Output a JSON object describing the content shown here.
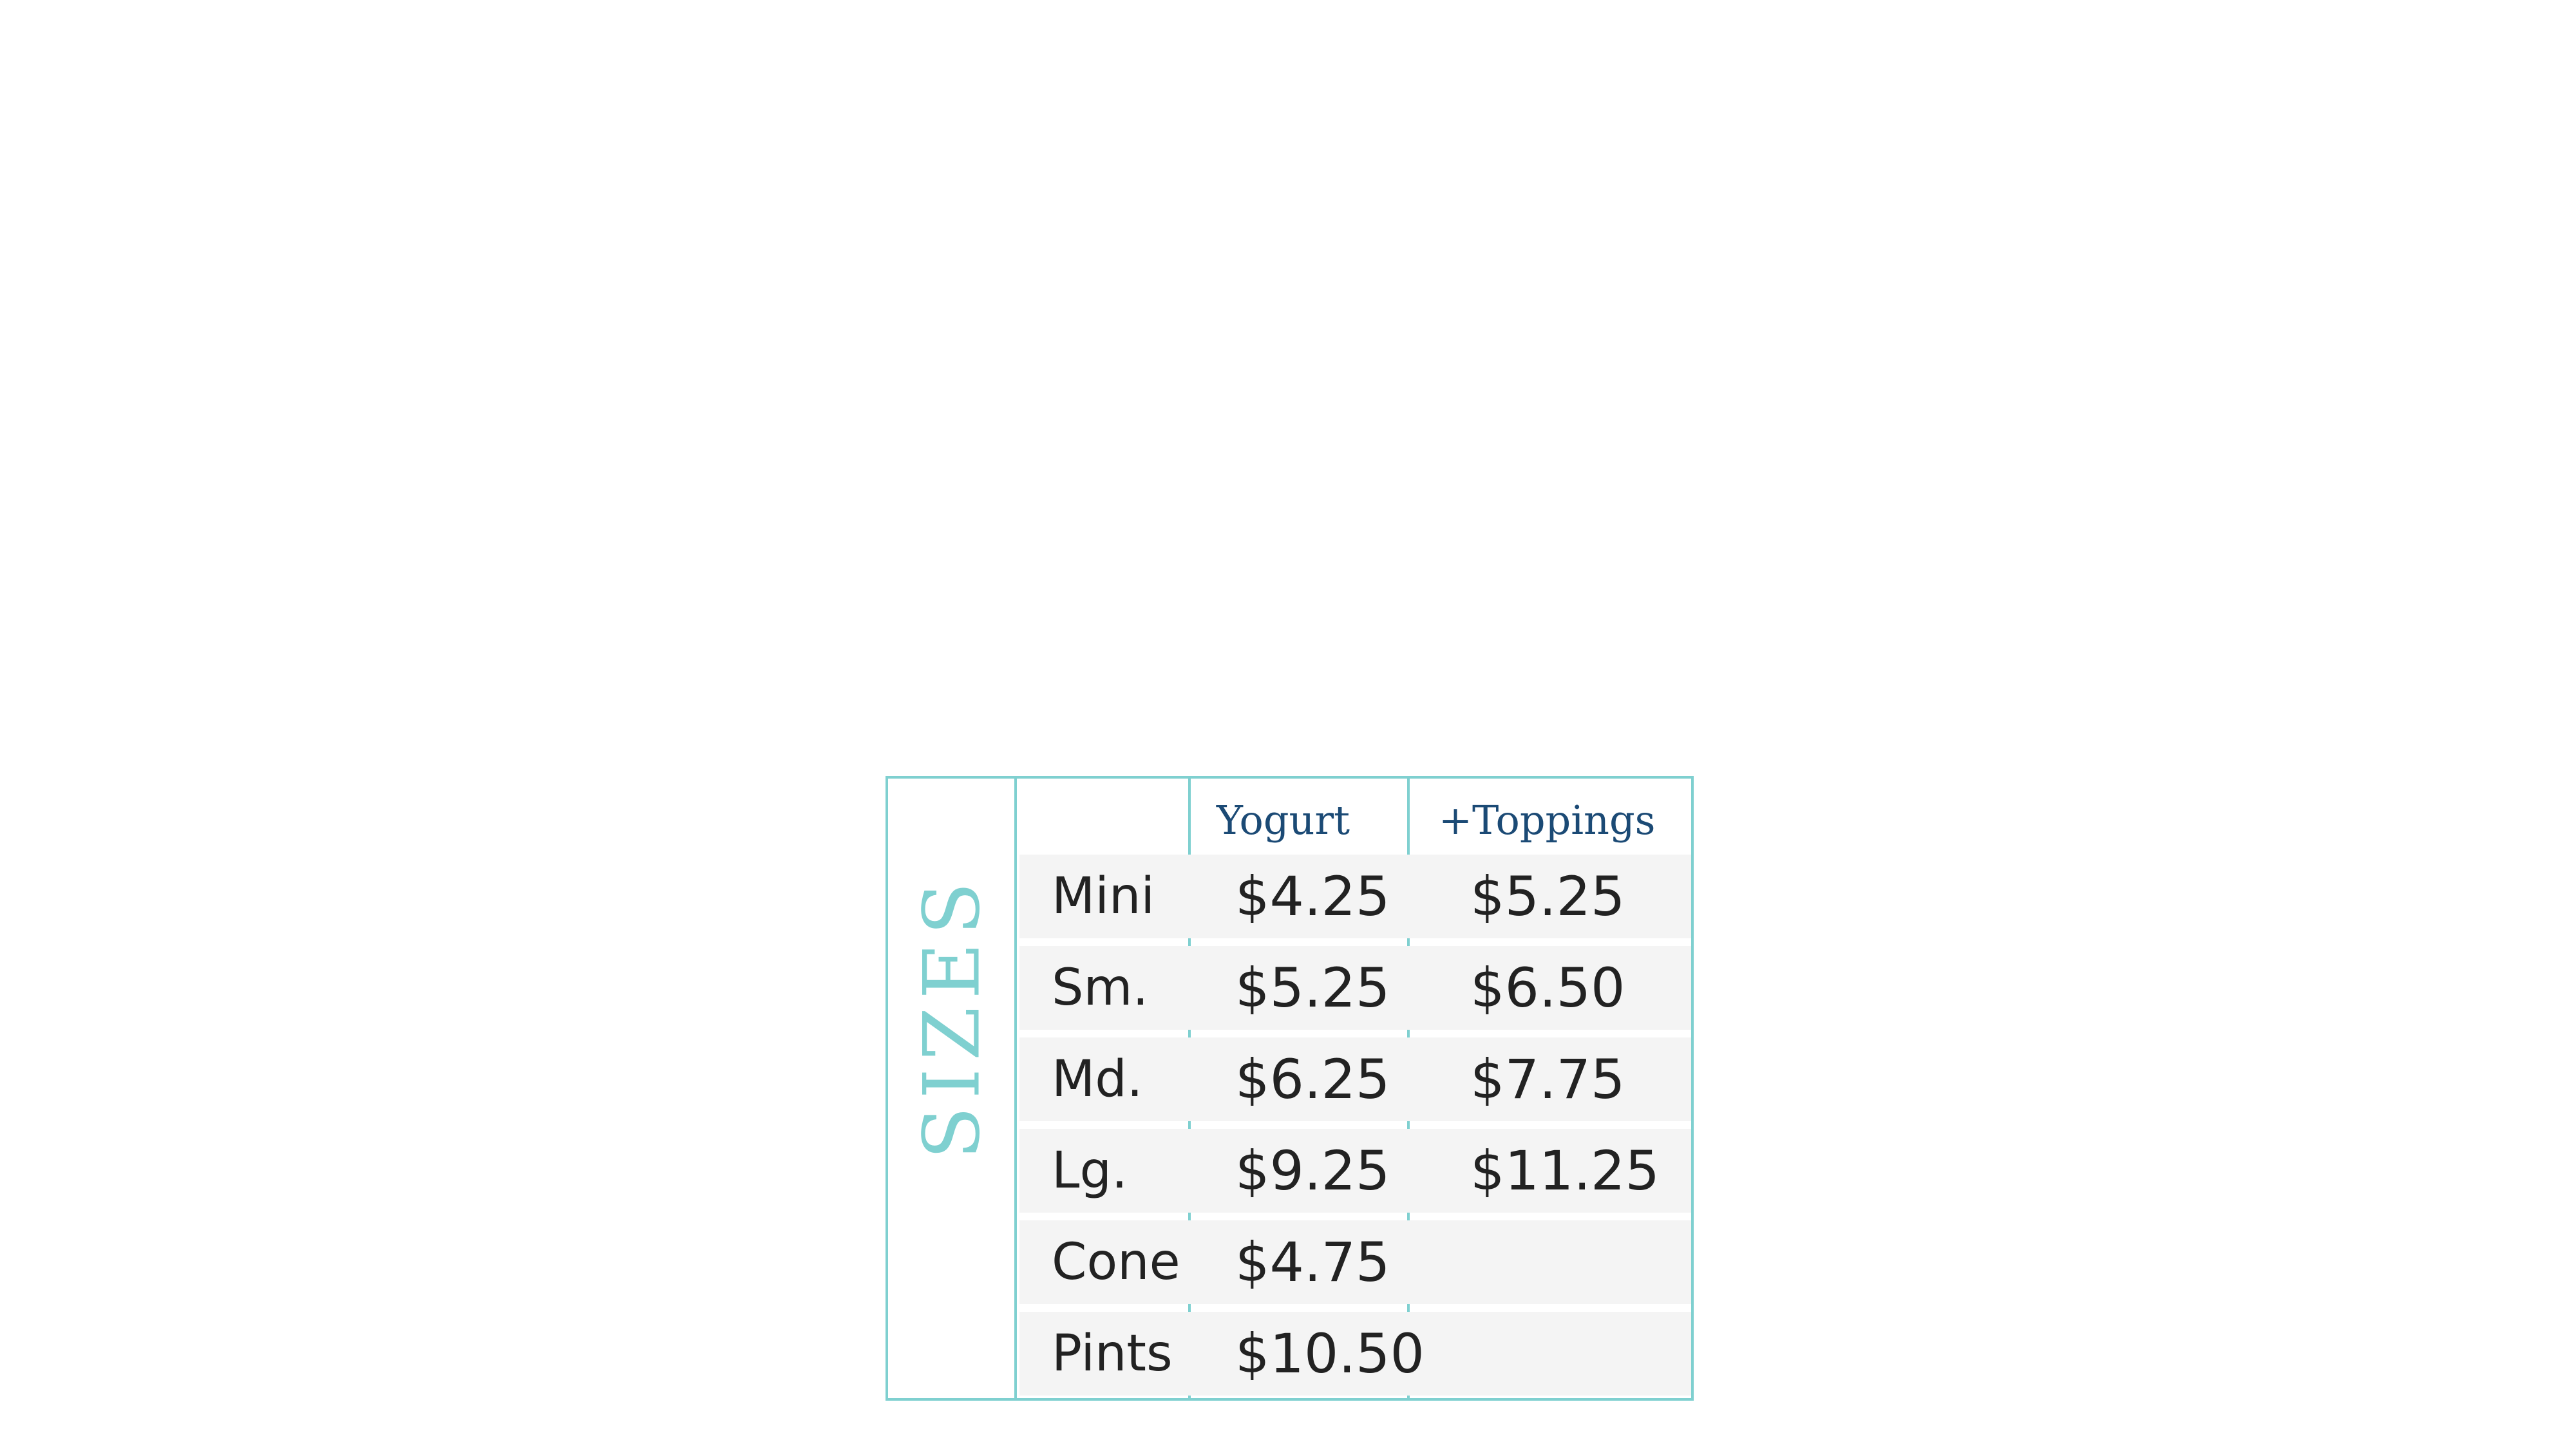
{
  "section_label": "SIZES",
  "columns": {
    "yogurt": "Yogurt",
    "toppings": "+Toppings"
  },
  "rows": [
    {
      "size": "Mini",
      "yogurt": "$4.25",
      "toppings": "$5.25"
    },
    {
      "size": "Sm.",
      "yogurt": "$5.25",
      "toppings": "$6.50"
    },
    {
      "size": "Md.",
      "yogurt": "$6.25",
      "toppings": "$7.75"
    },
    {
      "size": "Lg.",
      "yogurt": "$9.25",
      "toppings": "$11.25"
    },
    {
      "size": "Cone",
      "yogurt": "$4.75",
      "toppings": ""
    },
    {
      "size": "Pints",
      "yogurt": "$10.50",
      "toppings": ""
    }
  ],
  "colors": {
    "border": "#7fd0d0",
    "header_text": "#1b4a75",
    "row_background": "#f4f4f4",
    "body_text": "#222222"
  }
}
